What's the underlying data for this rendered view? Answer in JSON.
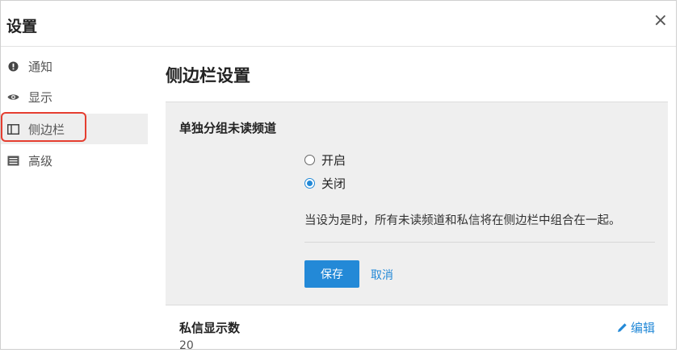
{
  "modal": {
    "title": "设置",
    "close_label": "×"
  },
  "sidebar": {
    "items": [
      {
        "label": "通知",
        "icon": "exclamation-circle-icon"
      },
      {
        "label": "显示",
        "icon": "eye-icon"
      },
      {
        "label": "侧边栏",
        "icon": "columns-icon",
        "active": true
      },
      {
        "label": "高级",
        "icon": "list-alt-icon"
      }
    ]
  },
  "content": {
    "title": "侧边栏设置",
    "group_unreads": {
      "label": "单独分组未读频道",
      "options": [
        {
          "label": "开启",
          "selected": false
        },
        {
          "label": "关闭",
          "selected": true
        }
      ],
      "help_text": "当设为是时，所有未读频道和私信将在侧边栏中组合在一起。",
      "save_label": "保存",
      "cancel_label": "取消"
    },
    "dm_count": {
      "label": "私信显示数",
      "value": "20",
      "edit_label": "编辑"
    }
  },
  "colors": {
    "accent": "#2389d7",
    "highlight": "#e53e30",
    "panel_bg": "#efefef",
    "active_nav_bg": "#eeeeee"
  }
}
